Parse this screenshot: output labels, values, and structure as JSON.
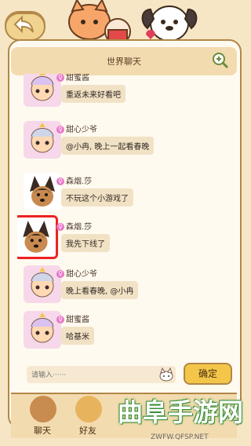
{
  "header": {
    "title": "世界聊天"
  },
  "messages": [
    {
      "name": "甜蜜酱",
      "text": "重返未来好看吧",
      "avatar": "princess-avatar"
    },
    {
      "name": "甜心少爷",
      "text": "@小冉, 晚上一起看春晚",
      "avatar": "princess-avatar"
    },
    {
      "name": "森烟.莎",
      "text": "不玩这个小游戏了",
      "avatar": "dog-avatar"
    },
    {
      "name": "森烟.莎",
      "text": "我先下线了",
      "avatar": "dog-avatar"
    },
    {
      "name": "甜心少爷",
      "text": "晚上看春晚, @小冉",
      "avatar": "princess-avatar"
    },
    {
      "name": "甜蜜酱",
      "text": "哈基米",
      "avatar": "princess-avatar"
    }
  ],
  "input": {
    "placeholder": "请输入······"
  },
  "buttons": {
    "confirm": "确定"
  },
  "tabs": [
    {
      "label": "聊天"
    },
    {
      "label": "好友"
    }
  ],
  "watermark": {
    "text": "曲阜手游网",
    "url": "ZWFW.QFSP.NET"
  }
}
